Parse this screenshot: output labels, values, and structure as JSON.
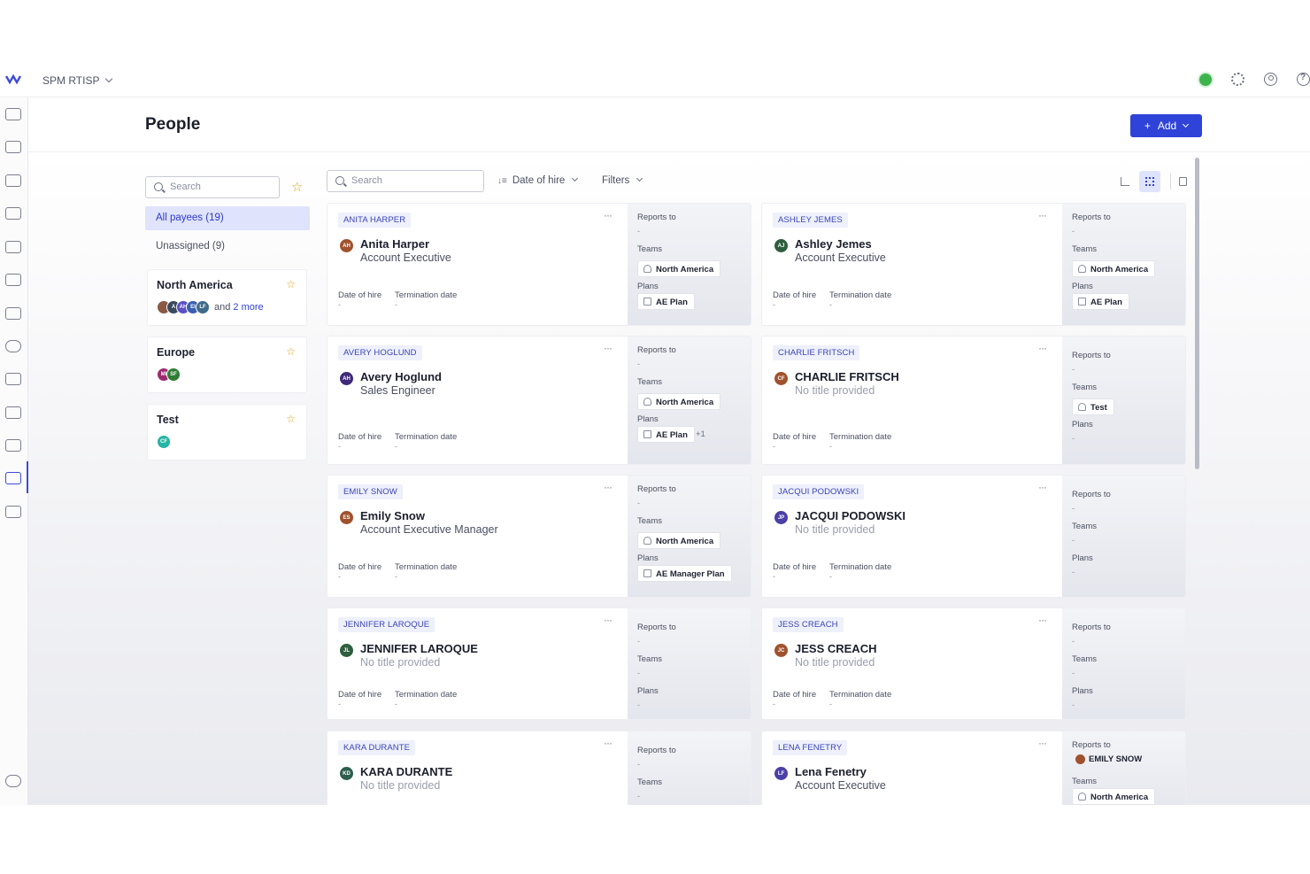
{
  "app": {
    "workspace": "SPM RTISP",
    "page_title": "People",
    "add_label": "Add",
    "status_color": "#3cb44b",
    "accent_color": "#2f43d8"
  },
  "top_icons": [
    "settings-gear-icon",
    "user-account-icon",
    "help-icon"
  ],
  "nav_icons": [
    "home-icon",
    "tasks-icon",
    "reports-icon",
    "workflow-icon",
    "dashboard-icon",
    "calendar-icon",
    "settings-icon",
    "activity-icon",
    "balance-icon",
    "edit-icon",
    "database-icon",
    "people-icon",
    "documents-icon",
    "sliders-icon"
  ],
  "groups": {
    "search_placeholder": "Search",
    "all_label": "All payees (19)",
    "unassigned_label": "Unassigned (9)",
    "teams": [
      {
        "name": "North America",
        "avatars": [
          {
            "initials": "",
            "color": "#8a5a44"
          },
          {
            "initials": "A",
            "color": "#3a4a5c"
          },
          {
            "initials": "AH",
            "color": "#5b4fc4"
          },
          {
            "initials": "EI",
            "color": "#3a5fb0"
          },
          {
            "initials": "LF",
            "color": "#3e6b8a"
          }
        ],
        "more_prefix": "and",
        "more_link": "2 more"
      },
      {
        "name": "Europe",
        "avatars": [
          {
            "initials": "MI",
            "color": "#9c2b6e"
          },
          {
            "initials": "SF",
            "color": "#2e7d32"
          }
        ],
        "more_prefix": "",
        "more_link": ""
      },
      {
        "name": "Test",
        "avatars": [
          {
            "initials": "CF",
            "color": "#26b3a3"
          }
        ],
        "more_prefix": "",
        "more_link": ""
      }
    ]
  },
  "toolbar": {
    "search_placeholder": "Search",
    "sort_label": "Date of hire",
    "filters_label": "Filters"
  },
  "labels": {
    "date_of_hire": "Date of hire",
    "termination_date": "Termination date",
    "reports_to": "Reports to",
    "teams": "Teams",
    "plans": "Plans",
    "dash": "-"
  },
  "people": [
    {
      "tag": "ANITA HARPER",
      "initials": "AH",
      "avatar_color": "#a0522d",
      "name": "Anita Harper",
      "title": "Account Executive",
      "reports_to": "-",
      "team": "North America",
      "plan": "AE Plan",
      "plan_extra": ""
    },
    {
      "tag": "ASHLEY JEMES",
      "initials": "AJ",
      "avatar_color": "#2e5e3e",
      "name": "Ashley Jemes",
      "title": "Account Executive",
      "reports_to": "-",
      "team": "North America",
      "plan": "AE Plan",
      "plan_extra": ""
    },
    {
      "tag": "AVERY HOGLUND",
      "initials": "AH",
      "avatar_color": "#3f2a7a",
      "name": "Avery Hoglund",
      "title": "Sales Engineer",
      "reports_to": "-",
      "team": "North America",
      "plan": "AE Plan",
      "plan_extra": "+1"
    },
    {
      "tag": "CHARLIE FRITSCH",
      "initials": "CF",
      "avatar_color": "#a0522d",
      "name": "CHARLIE FRITSCH",
      "title": "No title provided",
      "reports_to": "-",
      "team": "Test",
      "plan": "-",
      "plan_extra": ""
    },
    {
      "tag": "EMILY SNOW",
      "initials": "ES",
      "avatar_color": "#a0522d",
      "name": "Emily Snow",
      "title": "Account Executive Manager",
      "reports_to": "-",
      "team": "North America",
      "plan": "AE Manager Plan",
      "plan_extra": ""
    },
    {
      "tag": "JACQUI PODOWSKI",
      "initials": "JP",
      "avatar_color": "#4b3fa8",
      "name": "JACQUI PODOWSKI",
      "title": "No title provided",
      "reports_to": "-",
      "team": "-",
      "plan": "-",
      "plan_extra": ""
    },
    {
      "tag": "JENNIFER LAROQUE",
      "initials": "JL",
      "avatar_color": "#2e5e3e",
      "name": "JENNIFER LAROQUE",
      "title": "No title provided",
      "reports_to": "-",
      "team": "-",
      "plan": "-",
      "plan_extra": ""
    },
    {
      "tag": "JESS CREACH",
      "initials": "JC",
      "avatar_color": "#a0522d",
      "name": "JESS CREACH",
      "title": "No title provided",
      "reports_to": "-",
      "team": "-",
      "plan": "-",
      "plan_extra": ""
    },
    {
      "tag": "KARA DURANTE",
      "initials": "KD",
      "avatar_color": "#2e5e4e",
      "name": "KARA DURANTE",
      "title": "No title provided",
      "reports_to": "-",
      "team": "-",
      "plan": "",
      "plan_extra": ""
    },
    {
      "tag": "LENA FENETRY",
      "initials": "LF",
      "avatar_color": "#4b3fa8",
      "name": "Lena Fenetry",
      "title": "Account Executive",
      "reports_to": "EMILY SNOW",
      "team": "North America",
      "plan": "",
      "plan_extra": ""
    }
  ]
}
